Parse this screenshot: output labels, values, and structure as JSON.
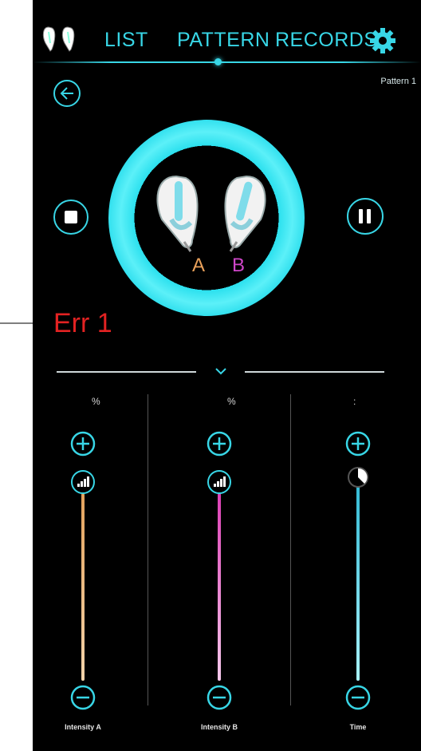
{
  "nav": {
    "tabs": [
      {
        "label": "LIST"
      },
      {
        "label": "PATTERN"
      },
      {
        "label": "RECORDS"
      }
    ],
    "active_tab": "PATTERN"
  },
  "pattern": {
    "label": "Pattern  1"
  },
  "device": {
    "label_a": "A",
    "label_b": "B"
  },
  "error": {
    "text": "Err 1"
  },
  "sliders": [
    {
      "unit": "%",
      "label": "Intensity A",
      "color": "#e7a96a",
      "icon": "signal-icon"
    },
    {
      "unit": "%",
      "label": "Intensity B",
      "color": "#e24fbd",
      "icon": "signal-icon"
    },
    {
      "unit": ":",
      "label": "Time",
      "color": "#36c6dc",
      "icon": "clock-icon"
    }
  ],
  "colors": {
    "accent": "#38d6e6",
    "error": "#e32222",
    "label_a": "#e8a05a",
    "label_b": "#cf46c9"
  }
}
